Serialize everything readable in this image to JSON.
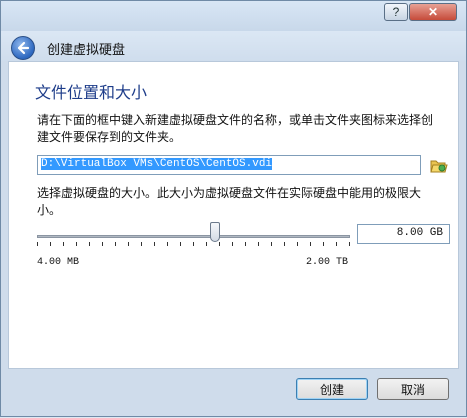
{
  "window": {
    "help_label": "?",
    "close_label": "✕"
  },
  "header": {
    "title": "创建虚拟硬盘"
  },
  "section": {
    "title": "文件位置和大小",
    "description": "请在下面的框中键入新建虚拟硬盘文件的名称，或单击文件夹图标来选择创建文件要保存到的文件夹。"
  },
  "location": {
    "path": "D:\\VirtualBox VMs\\CentOS\\CentOS.vdi"
  },
  "size": {
    "description": "选择虚拟硬盘的大小。此大小为虚拟硬盘文件在实际硬盘中能用的极限大小。",
    "value": "8.00 GB",
    "min_label": "4.00 MB",
    "max_label": "2.00 TB",
    "slider_level_percent": 57
  },
  "buttons": {
    "create": "创建",
    "cancel": "取消"
  },
  "icons": {
    "back": "back-arrow-icon",
    "folder": "folder-open-icon"
  },
  "colors": {
    "title_blue": "#1e3d8a",
    "selection": "#3399ff"
  }
}
